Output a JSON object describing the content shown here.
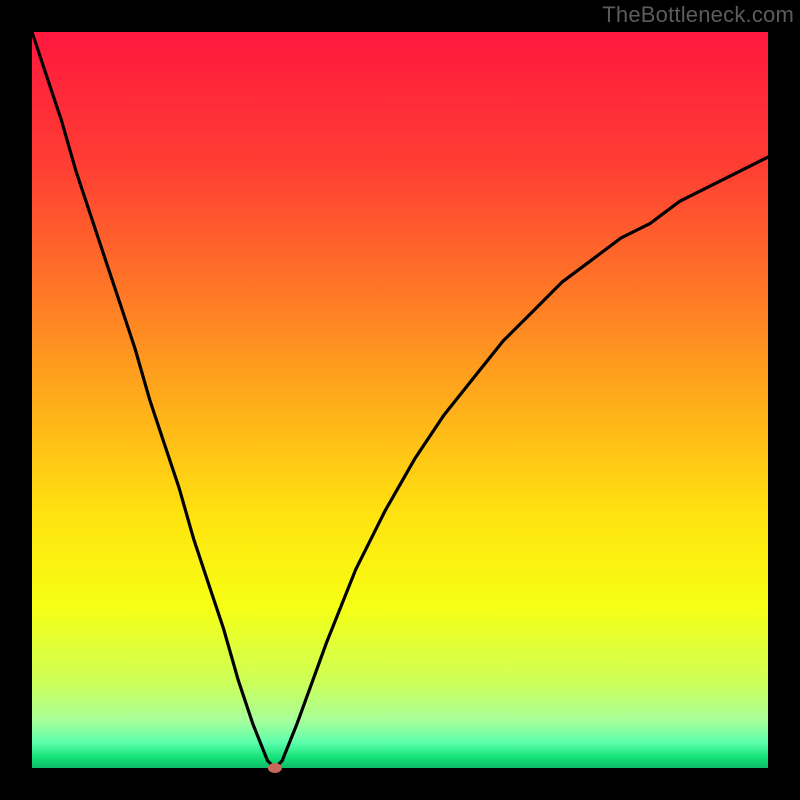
{
  "watermark": "TheBottleneck.com",
  "colors": {
    "frame": "#000000",
    "curve": "#000000",
    "marker": "#c56a5a",
    "gradient_stops": [
      {
        "offset": 0.0,
        "color": "#ff183f"
      },
      {
        "offset": 0.18,
        "color": "#ff3d33"
      },
      {
        "offset": 0.36,
        "color": "#ff7a26"
      },
      {
        "offset": 0.52,
        "color": "#ffb319"
      },
      {
        "offset": 0.66,
        "color": "#ffe40f"
      },
      {
        "offset": 0.78,
        "color": "#f6ff14"
      },
      {
        "offset": 0.88,
        "color": "#ceff55"
      },
      {
        "offset": 0.935,
        "color": "#a8ff9a"
      },
      {
        "offset": 0.965,
        "color": "#5effad"
      },
      {
        "offset": 0.985,
        "color": "#16e47a"
      },
      {
        "offset": 1.0,
        "color": "#0dbb66"
      }
    ]
  },
  "chart_data": {
    "type": "line",
    "title": "",
    "xlabel": "",
    "ylabel": "",
    "x": [
      0.0,
      0.02,
      0.04,
      0.06,
      0.08,
      0.1,
      0.12,
      0.14,
      0.16,
      0.18,
      0.2,
      0.22,
      0.24,
      0.26,
      0.28,
      0.3,
      0.32,
      0.33,
      0.34,
      0.36,
      0.4,
      0.44,
      0.48,
      0.52,
      0.56,
      0.6,
      0.64,
      0.68,
      0.72,
      0.76,
      0.8,
      0.84,
      0.88,
      0.92,
      0.96,
      1.0
    ],
    "values": [
      1.0,
      0.94,
      0.88,
      0.81,
      0.75,
      0.69,
      0.63,
      0.57,
      0.5,
      0.44,
      0.38,
      0.31,
      0.25,
      0.19,
      0.12,
      0.06,
      0.01,
      0.0,
      0.01,
      0.06,
      0.17,
      0.27,
      0.35,
      0.42,
      0.48,
      0.53,
      0.58,
      0.62,
      0.66,
      0.69,
      0.72,
      0.74,
      0.77,
      0.79,
      0.81,
      0.83
    ],
    "xlim": [
      0,
      1
    ],
    "ylim": [
      0,
      1
    ],
    "marker": {
      "x": 0.33,
      "y": 0.0
    },
    "legend": false,
    "grid": false
  }
}
